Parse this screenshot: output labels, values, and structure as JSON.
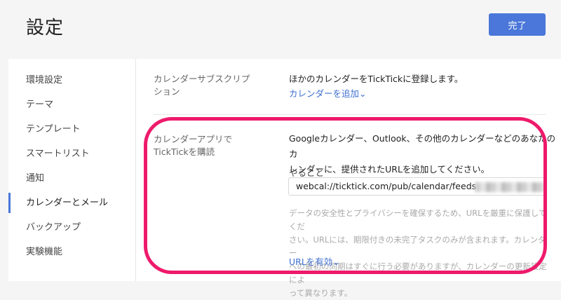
{
  "header": {
    "title": "設定",
    "done_label": "完了"
  },
  "sidebar": {
    "items": [
      {
        "label": "環境設定"
      },
      {
        "label": "テーマ"
      },
      {
        "label": "テンプレート"
      },
      {
        "label": "スマートリスト"
      },
      {
        "label": "通知"
      },
      {
        "label": "カレンダーとメール",
        "active": true
      },
      {
        "label": "バックアップ"
      },
      {
        "label": "実験機能"
      }
    ]
  },
  "subscription": {
    "label_line1": "カレンダーサブスクリプ",
    "label_line2": "ション",
    "description": "ほかのカレンダーをTickTickに登録します。",
    "link_label": "カレンダーを追加⌄"
  },
  "app_subscribe": {
    "label_line1": "カレンダーアプリで",
    "label_line2": "TickTickを購読",
    "description_line1": "Googleカレンダー、Outlook、その他のカレンダーなどのあなたのカ",
    "description_line2": "レンダーに、提供されたURLを追加してください。",
    "field_label": "やること",
    "url_value": "webcal://ticktick.com/pub/calendar/feeds",
    "note_line1": "データの安全性とプライバシーを確保するため、URLを厳重に保護してくだ",
    "note_line2": "さい。URLには、期限付きの未完了タスクのみが含まれます。カレンダー",
    "note_line3": "への最初の同期はすぐに行う必要がありますが、カレンダーの更新設定によ",
    "note_line4": "って異なります。",
    "link_label": "URLを有効⌄"
  },
  "colors": {
    "accent": "#4a77d9",
    "highlight": "#ee1a6b",
    "link": "#3f6fd1"
  }
}
